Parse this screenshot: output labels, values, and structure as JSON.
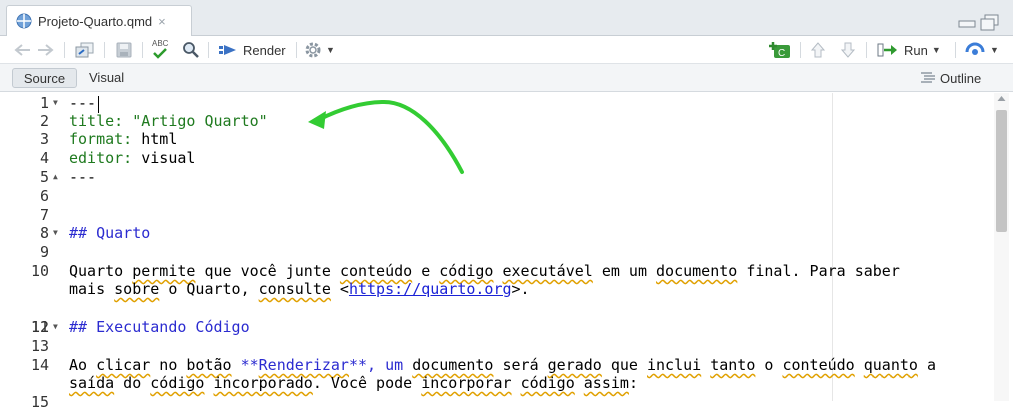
{
  "tab": {
    "title": "Projeto-Quarto.qmd",
    "close": "×"
  },
  "toolbar": {
    "spell_abc": "ABC",
    "render_label": "Render",
    "run_label": "Run"
  },
  "modebar": {
    "source_label": "Source",
    "visual_label": "Visual",
    "outline_label": "Outline"
  },
  "editor": {
    "lines": [
      {
        "n": "1",
        "text": "---"
      },
      {
        "n": "2",
        "key": "title:",
        "value": " \"Artigo Quarto\""
      },
      {
        "n": "3",
        "key": "format:",
        "value": " html"
      },
      {
        "n": "4",
        "key": "editor:",
        "value": " visual"
      },
      {
        "n": "5",
        "text": "---"
      },
      {
        "n": "6",
        "text": ""
      },
      {
        "n": "7",
        "text": ""
      },
      {
        "n": "8",
        "text": "## Quarto"
      },
      {
        "n": "9",
        "text": ""
      },
      {
        "n": "10",
        "p1": "Quarto ",
        "w1": "permite",
        "p2": " que você junte ",
        "w2": "conteúdo",
        "p3": " e ",
        "w3": "código",
        "p4": " ",
        "w4": "executável",
        "p5": " em um ",
        "w5": "documento",
        "p6": " final. Para saber"
      },
      {
        "n": "",
        "p1": "mais ",
        "w1": "sobre",
        "p2": " o Quarto, ",
        "w2": "consulte",
        "p3": " <",
        "link": "https://quarto.org",
        "p4": ">."
      },
      {
        "n": "11",
        "text": ""
      },
      {
        "n": "12",
        "text": "## Executando Código"
      },
      {
        "n": "13",
        "text": ""
      },
      {
        "n": "14",
        "p1": "Ao ",
        "w1": "clicar",
        "p2": " no ",
        "w2": "botão",
        "p3": " **",
        "w3": "Renderizar",
        "p4": "**, um ",
        "w4": "documento",
        "p5": " será ",
        "w5": "gerado",
        "p6": " que ",
        "w6": "inclui",
        "p7": " ",
        "w7": "tanto",
        "p8": " o ",
        "w8": "conteúdo",
        "p9": " ",
        "w9": "quanto",
        "p10": " a"
      },
      {
        "n": "",
        "p1": "",
        "w1": "saída",
        "p2": " do ",
        "w2": "código",
        "p3": " ",
        "w3": "incorporado",
        "p4": ". Você pode ",
        "w4": "incorporar",
        "p5": " ",
        "w5": "código",
        "p6": " ",
        "w6": "assim",
        "p7": ":"
      },
      {
        "n": "15",
        "text": ""
      }
    ]
  },
  "colors": {
    "yaml": "#1f7a1f",
    "heading": "#2b2bd0",
    "arrow": "#33cc33",
    "toolbar_bg": "#e7ebef"
  }
}
